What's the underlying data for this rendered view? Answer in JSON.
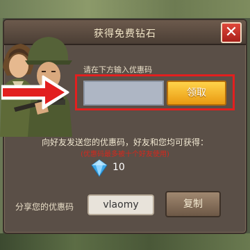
{
  "dialog": {
    "title": "获得免费钻石",
    "close_label": "✕"
  },
  "redeem": {
    "prompt": "请在下方输入优惠码",
    "input_value": "",
    "input_placeholder": "",
    "claim_label": "领取"
  },
  "invite": {
    "text": "向好友发送您的优惠码，好友和您均可获得：",
    "note": "(优惠码最多被十个好友使用)",
    "reward_icon": "diamond-icon",
    "reward_amount": "10"
  },
  "share": {
    "label": "分享您的优惠码",
    "code": "vlaomy",
    "copy_label": "复制"
  },
  "colors": {
    "highlight": "#e21f1f",
    "claim_button": "#f5b526",
    "note_text": "#d6281d"
  }
}
